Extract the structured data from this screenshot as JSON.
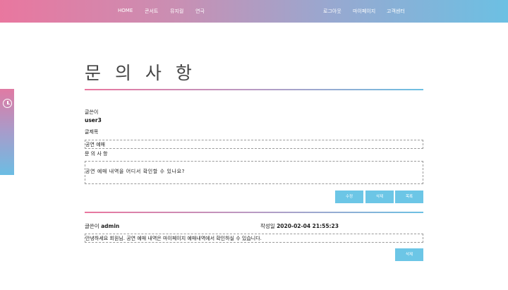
{
  "nav": {
    "left": [
      "HOME",
      "콘서트",
      "뮤지컬",
      "연극"
    ],
    "right": [
      "로그아웃",
      "마이페이지",
      "고객센터"
    ]
  },
  "page": {
    "title": "문 의 사 항"
  },
  "post": {
    "author_label": "글쓴이",
    "author": "user3",
    "subject_label": "글제목",
    "subject": "공연 예매",
    "category": "문 의 사 항",
    "content": "공연 예매 내역을 어디서 확인할 수 있나요?"
  },
  "actions": {
    "edit": "수정",
    "delete": "삭제",
    "list": "목록"
  },
  "reply": {
    "author_label": "글쓴이",
    "author": "admin",
    "date_label": "작성일",
    "date": "2020-02-04 21:55:23",
    "content": "안녕하세요 회원님. 공연 예매 내역은 마이페이지 예매내역에서 확인하실 수 있습니다.",
    "delete": "삭제"
  },
  "colors": {
    "accent_pink": "#e9779f",
    "accent_blue": "#6cc0e3",
    "button": "#6cc6e6"
  },
  "icons": {
    "side_widget": "clock-icon"
  }
}
